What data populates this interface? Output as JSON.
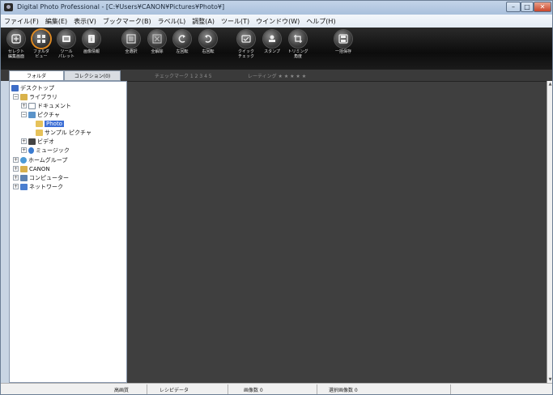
{
  "window": {
    "title": "Digital Photo Professional - [C:¥Users¥CANON¥Pictures¥Photo¥]",
    "minimize_glyph": "–",
    "maximize_glyph": "□",
    "close_glyph": "✕"
  },
  "menu": [
    "ファイル(F)",
    "編集(E)",
    "表示(V)",
    "ブックマーク(B)",
    "ラベル(L)",
    "調整(A)",
    "ツール(T)",
    "ウインドウ(W)",
    "ヘルプ(H)"
  ],
  "toolbar": {
    "tools": [
      {
        "label": "セレクト\n編集画面",
        "icon": "select-edit-icon"
      },
      {
        "label": "フォルダ\nビュー",
        "icon": "folder-view-icon",
        "active": true
      },
      {
        "label": "ツール\nパレット",
        "icon": "tool-palette-icon"
      },
      {
        "label": "画像情報",
        "icon": "info-icon"
      },
      {
        "label": "全選択",
        "icon": "select-all-icon"
      },
      {
        "label": "全解除",
        "icon": "deselect-all-icon"
      },
      {
        "label": "左回転",
        "icon": "rotate-left-icon"
      },
      {
        "label": "右回転",
        "icon": "rotate-right-icon"
      },
      {
        "label": "クイック\nチェック",
        "icon": "quick-check-icon"
      },
      {
        "label": "スタンプ",
        "icon": "stamp-icon"
      },
      {
        "label": "トリミング\n角度",
        "icon": "trim-angle-icon"
      },
      {
        "label": "一括保存",
        "icon": "batch-save-icon"
      }
    ]
  },
  "panel": {
    "tab_folder": "フォルダ",
    "tab_collection": "コレクション(0)",
    "check_mark_filter": "チェックマーク  1  2  3  4  5",
    "rating_filter": "レーティング  ★  ★  ★  ★  ★"
  },
  "tree": [
    {
      "label": "デスクトップ",
      "icon": "desktop-icon",
      "expander": ""
    },
    {
      "label": "ライブラリ",
      "icon": "library-icon",
      "expander": "−"
    },
    {
      "label": "ドキュメント",
      "icon": "document-icon",
      "expander": "+"
    },
    {
      "label": "ピクチャ",
      "icon": "picture-icon",
      "expander": "−"
    },
    {
      "label": "Photo",
      "icon": "folder-icon",
      "expander": "",
      "selected": true
    },
    {
      "label": "サンプル ピクチャ",
      "icon": "folder-icon",
      "expander": ""
    },
    {
      "label": "ビデオ",
      "icon": "video-icon",
      "expander": "+"
    },
    {
      "label": "ミュージック",
      "icon": "music-icon",
      "expander": "+"
    },
    {
      "label": "ホームグループ",
      "icon": "homegroup-icon",
      "expander": "+"
    },
    {
      "label": "CANON",
      "icon": "user-icon",
      "expander": "+"
    },
    {
      "label": "コンピューター",
      "icon": "computer-icon",
      "expander": "+"
    },
    {
      "label": "ネットワーク",
      "icon": "network-icon",
      "expander": "+"
    }
  ],
  "scrollbar": {
    "up_glyph": "▲",
    "down_glyph": "▼"
  },
  "status": {
    "quality": "高画質",
    "recipe": "レシピデータ",
    "image_count": "画像数 0",
    "selected_count": "選択画像数 0"
  }
}
